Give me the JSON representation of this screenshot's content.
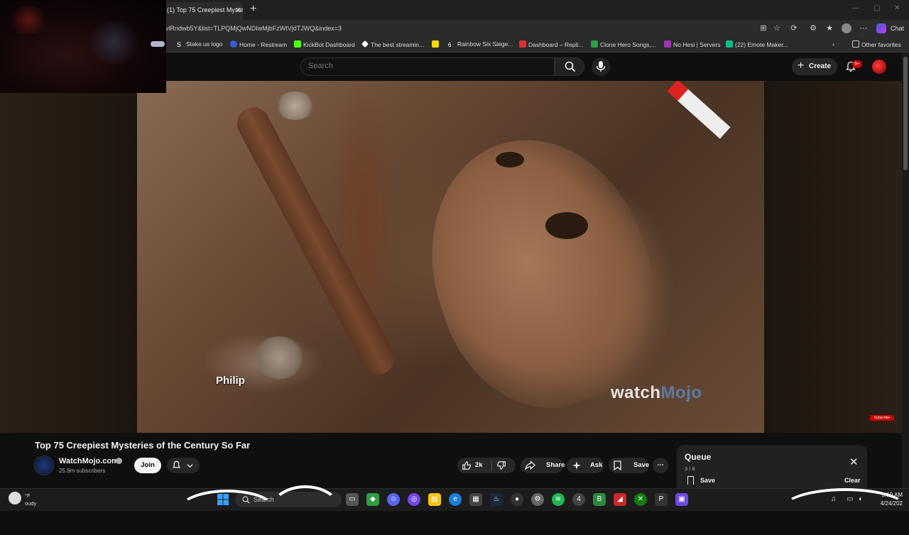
{
  "browser": {
    "tab_title": "(1) Top 75 Creepiest Myste",
    "url": "vlRndwb5Y&list=TLPQMjQwNDIwMjbFzWtVjdTJWQ&index=3",
    "chat_label": "Chat",
    "other_favorites": "Other favorites",
    "bookmarks": [
      {
        "label": "Stake.us logo",
        "color": "#2b2b2b",
        "icon": "S"
      },
      {
        "label": "Home - Restream",
        "color": "#3b5bdb",
        "icon": "R"
      },
      {
        "label": "KickBot Dashboard",
        "color": "#53fc18",
        "icon": "K"
      },
      {
        "label": "The best streamin...",
        "color": "#ffffff",
        "icon": "◆"
      },
      {
        "label": "",
        "color": "#f5d90a",
        "icon": "◘"
      },
      {
        "label": "Rainbow Six Siege...",
        "color": "#2b2b2b",
        "icon": "6"
      },
      {
        "label": "Dashboard – Repli...",
        "color": "#e03131",
        "icon": "◉"
      },
      {
        "label": "Clone Hero Songs,...",
        "color": "#2f9e44",
        "icon": "▦"
      },
      {
        "label": "No Hesi | Servers",
        "color": "#9c36b5",
        "icon": "▲"
      },
      {
        "label": "(22) Emote Maker...",
        "color": "#12b886",
        "icon": "☺"
      }
    ]
  },
  "youtube": {
    "search_placeholder": "Search",
    "create_label": "Create",
    "notif_badge": "9+"
  },
  "video": {
    "caption": "Philip",
    "watermark_main": "watch",
    "watermark_tail": "Mojo",
    "subscribe_mini": "Subscribe",
    "title": "Top 75 Creepiest Mysteries of the Century So Far",
    "channel": "WatchMojo.com",
    "subscribers": "25.9m subscribers",
    "join_label": "Join",
    "like_count": "2k",
    "share_label": "Share",
    "ask_label": "Ask",
    "save_label": "Save",
    "more_label": "⋯"
  },
  "queue": {
    "title": "Queue",
    "count": "3 / 8",
    "save_label": "Save",
    "clear_label": "Clear"
  },
  "taskbar": {
    "temp": "°F",
    "weather": "oudy",
    "search_label": "Search",
    "time": "3:19 AM",
    "date": "4/24/202"
  },
  "colors": {
    "youtube_red": "#cc0000",
    "background": "#0f0f0f"
  }
}
